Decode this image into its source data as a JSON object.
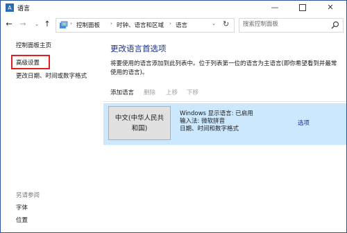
{
  "window": {
    "title": "语言",
    "buttons": {
      "minimize": "—",
      "close": "✕"
    }
  },
  "nav": {
    "back": "←",
    "forward": "→",
    "recent": "⌄",
    "up": "↑",
    "breadcrumb": [
      "控制面板",
      "时钟、语言和区域",
      "语言"
    ],
    "separator": "›",
    "dropdown": "⌄",
    "refresh": "↻",
    "search_placeholder": "搜索控制面板"
  },
  "sidebar": {
    "home": "控制面板主页",
    "advanced": "高级设置",
    "date_time": "更改日期、时间或数字格式",
    "see_also": "另请参阅",
    "font": "字体",
    "location": "位置"
  },
  "main": {
    "heading": "更改语言首选项",
    "description": "将要使用的语言添加到此列表中。位于列表第一位的语言为主语言(即你希望看到并最常使用的语言)。",
    "toolbar": {
      "add": "添加语言",
      "remove": "删除",
      "move_up": "上移",
      "move_down": "下移"
    },
    "language": {
      "name": "中文(中华人民共和国)",
      "display": "Windows 显示语言: 已启用",
      "input": "输入法: 微软拼音",
      "formats": "日期、时间和数字格式",
      "options": "选项"
    }
  },
  "colors": {
    "highlight_border": "#e02020",
    "selected_row": "#cce8ff",
    "link": "#1e3287"
  }
}
